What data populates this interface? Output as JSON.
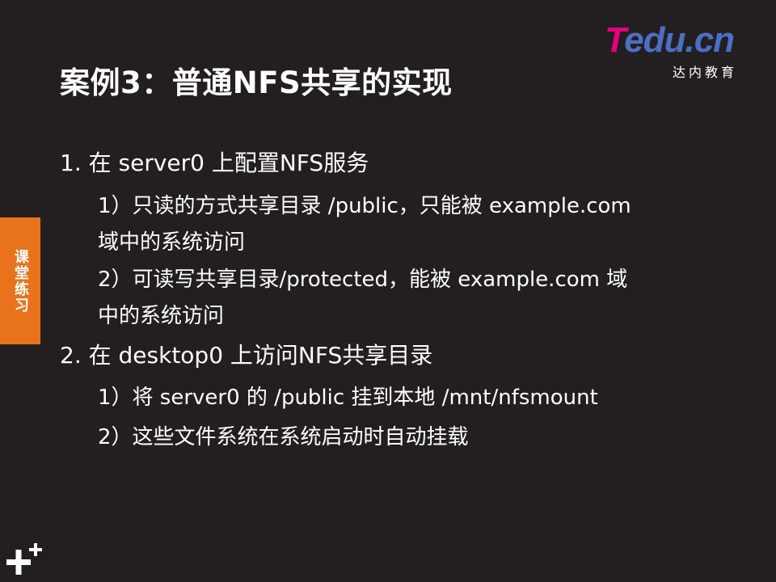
{
  "slide": {
    "title": "案例3：普通NFS共享的实现",
    "side_tab": "课堂练习",
    "logo": {
      "brand_t": "T",
      "brand_rest": "edu.cn",
      "subtitle": "达内教育"
    },
    "lines": [
      "1. 在 server0 上配置NFS服务",
      "1）只读的方式共享目录 /public，只能被 example.com",
      "域中的系统访问",
      "2）可读写共享目录/protected，能被  example.com 域",
      "中的系统访问",
      "2. 在 desktop0 上访问NFS共享目录",
      "1）将 server0 的 /public 挂到本地 /mnt/nfsmount",
      "2）这些文件系统在系统启动时自动挂载"
    ]
  },
  "colors": {
    "background": "#231f20",
    "tab": "#e8731c",
    "logo_pink": "#e6007e",
    "logo_blue": "#4b6fc4"
  }
}
